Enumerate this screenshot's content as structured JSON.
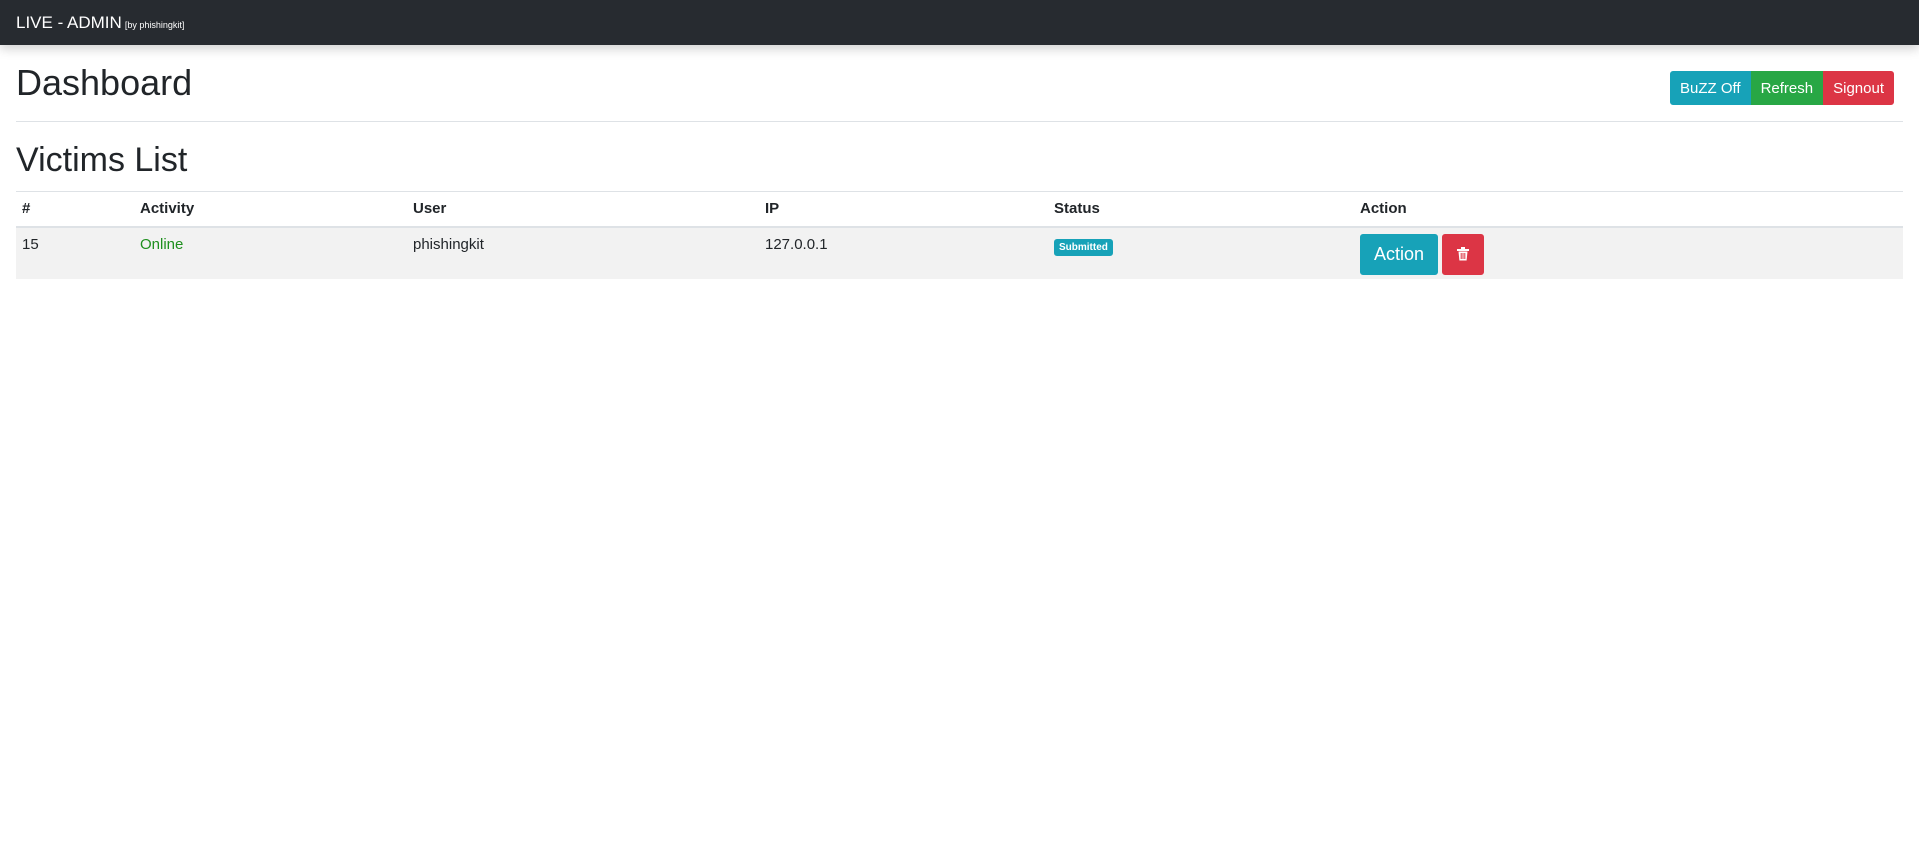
{
  "navbar": {
    "brand": "LIVE - ADMIN",
    "brand_sub": "[by phishingkit]"
  },
  "header": {
    "title": "Dashboard",
    "buttons": {
      "buzz_off": "BuZZ Off",
      "refresh": "Refresh",
      "signout": "Signout"
    }
  },
  "victims": {
    "title": "Victims List",
    "columns": [
      "#",
      "Activity",
      "User",
      "IP",
      "Status",
      "Action"
    ],
    "rows": [
      {
        "id": "15",
        "activity": "Online",
        "user": "phishingkit",
        "ip": "127.0.0.1",
        "status": "Submitted",
        "action_label": "Action",
        "delete_icon": "trash-icon"
      }
    ]
  },
  "colors": {
    "navbar": "#272b30",
    "info": "#17a2b8",
    "success": "#28a745",
    "danger": "#dc3545",
    "online": "#1e8f1e"
  }
}
